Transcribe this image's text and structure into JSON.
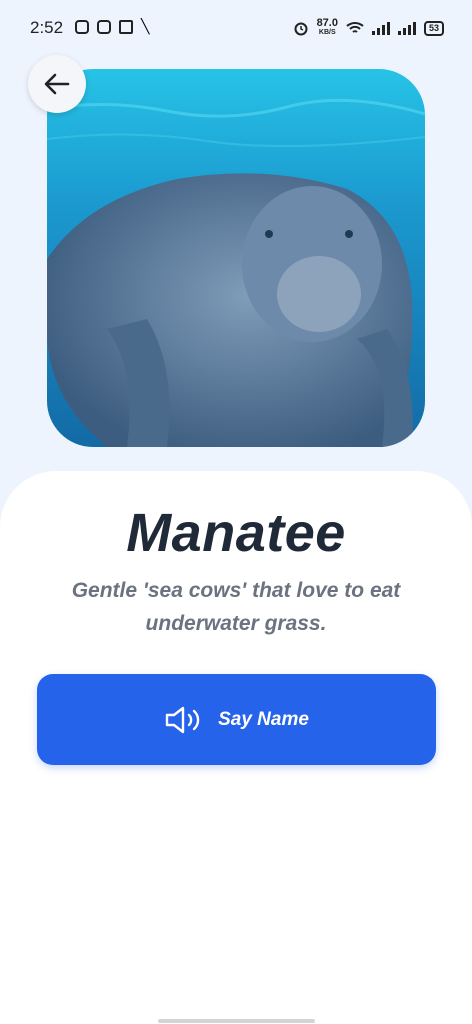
{
  "status_bar": {
    "time": "2:52",
    "network_speed_value": "87.0",
    "network_speed_unit": "KB/S",
    "battery": "53"
  },
  "hero_image": {
    "icon": "manatee-photo",
    "water_color": "#1aa7d8"
  },
  "nav": {
    "back_icon": "arrow-left-icon"
  },
  "animal": {
    "name": "Manatee",
    "description_line1": "Gentle 'sea cows' that love to eat",
    "description_line2": "underwater grass."
  },
  "action": {
    "say_name_label": "Say Name",
    "icon": "speaker-icon",
    "color": "#2563eb"
  }
}
